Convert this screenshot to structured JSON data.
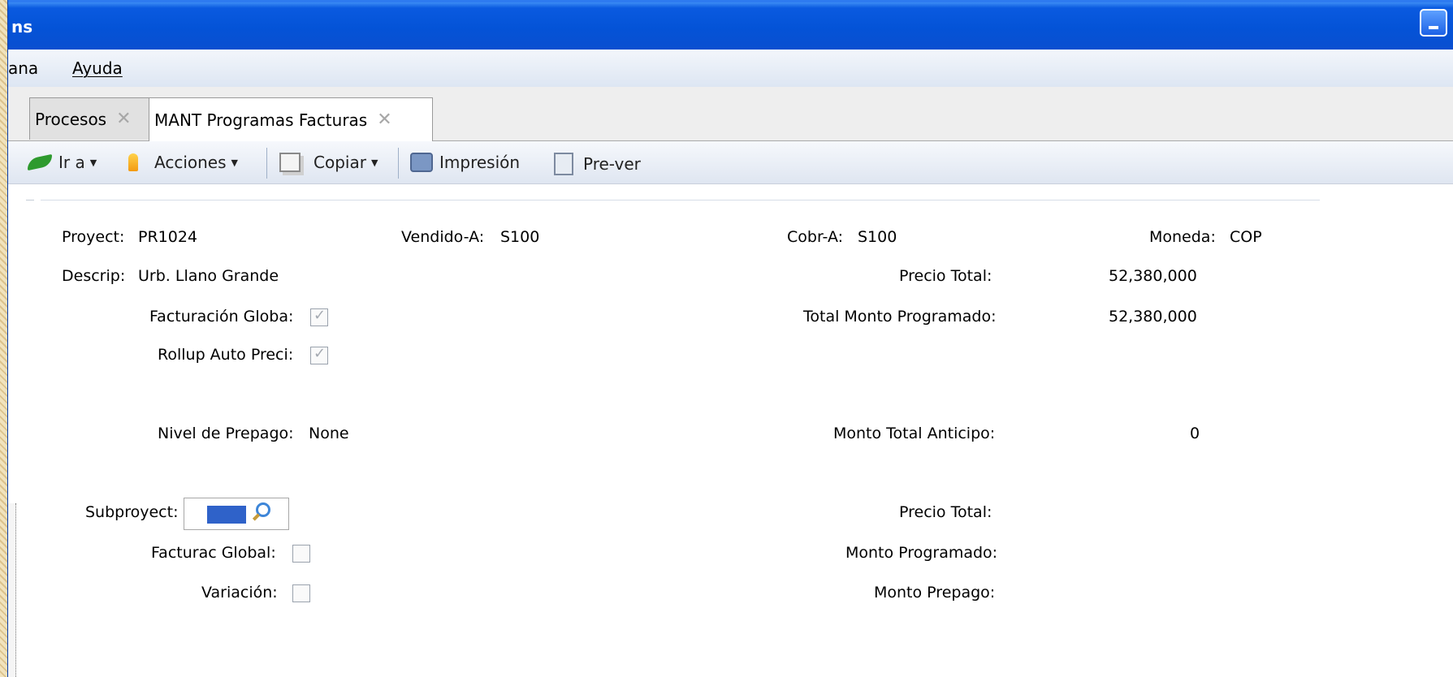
{
  "window": {
    "title": "ns"
  },
  "menu": {
    "items": [
      "ana",
      "Ayuda"
    ]
  },
  "tabs": [
    {
      "label": "Procesos",
      "active": false
    },
    {
      "label": "MANT Programas Facturas",
      "active": true
    }
  ],
  "toolbar": {
    "go_label": "Ir a",
    "actions_label": "Acciones",
    "copy_label": "Copiar",
    "print_label": "Impresión",
    "preview_label": "Pre-ver"
  },
  "form": {
    "proyect_label": "Proyect:",
    "proyect_value": "PR1024",
    "vendido_label": "Vendido-A:",
    "vendido_value": "S100",
    "cobr_label": "Cobr-A:",
    "cobr_value": "S100",
    "moneda_label": "Moneda:",
    "moneda_value": "COP",
    "descrip_label": "Descrip:",
    "descrip_value": "Urb. Llano Grande",
    "precio_total_label": "Precio Total:",
    "precio_total_value": "52,380,000",
    "facturacion_global_label": "Facturación Globa:",
    "facturacion_global_checked": true,
    "total_monto_programado_label": "Total Monto Programado:",
    "total_monto_programado_value": "52,380,000",
    "rollup_label": "Rollup Auto Preci:",
    "rollup_checked": true,
    "nivel_prepago_label": "Nivel de Prepago:",
    "nivel_prepago_value": "None",
    "monto_total_anticipo_label": "Monto Total Anticipo:",
    "monto_total_anticipo_value": "0",
    "subproyect_label": "Subproyect:",
    "sub_precio_total_label": "Precio Total:",
    "facturac_global_label": "Facturac Global:",
    "facturac_global_checked": false,
    "monto_programado_label": "Monto Programado:",
    "variacion_label": "Variación:",
    "variacion_checked": false,
    "monto_prepago_label": "Monto Prepago:"
  }
}
